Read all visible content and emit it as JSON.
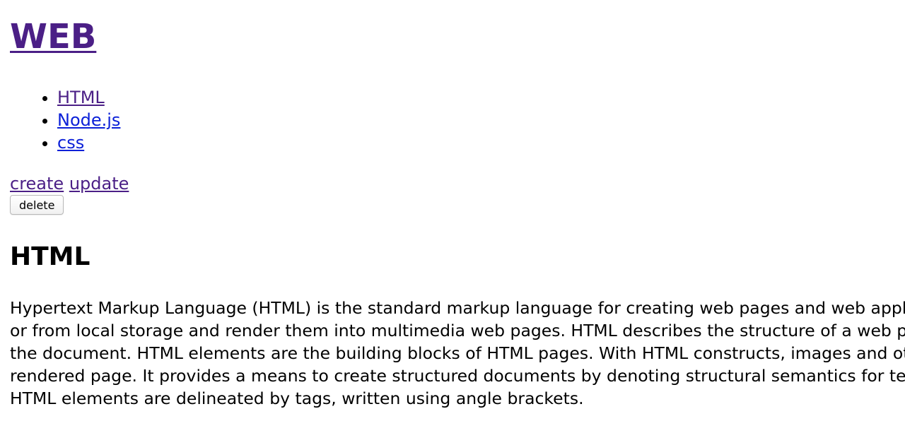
{
  "site": {
    "title": "WEB"
  },
  "nav": {
    "items": [
      {
        "label": "HTML",
        "state": "visited"
      },
      {
        "label": "Node.js",
        "state": "unvisited"
      },
      {
        "label": "css",
        "state": "unvisited"
      }
    ]
  },
  "controls": {
    "create_label": "create",
    "update_label": "update",
    "delete_label": "delete"
  },
  "topic": {
    "title": "HTML",
    "description_lines": [
      "Hypertext Markup Language (HTML) is the standard markup language for creating web pages and web applications. Web browsers receive HTML documents from a web server",
      "or from local storage and render them into multimedia web pages. HTML describes the structure of a web page semantically and originally included cues for the appearance of",
      "the document. HTML elements are the building blocks of HTML pages. With HTML constructs, images and other objects such as interactive forms may be embedded into the",
      "rendered page. It provides a means to create structured documents by denoting structural semantics for text such as headings, paragraphs, lists, links, quotes and other items.",
      "HTML elements are delineated by tags, written using angle brackets."
    ]
  },
  "colors": {
    "visited_link": "#4b1f86",
    "unvisited_link": "#0b20d8",
    "text": "#000000",
    "background": "#ffffff"
  }
}
